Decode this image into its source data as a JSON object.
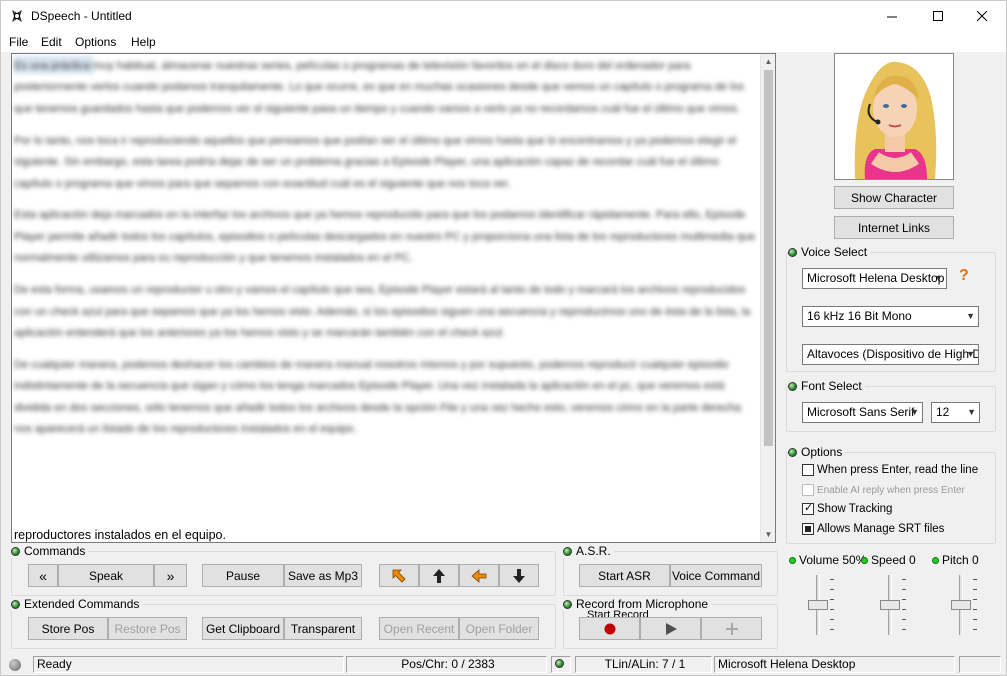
{
  "window": {
    "title": "DSpeech - Untitled"
  },
  "menu": {
    "file": "File",
    "edit": "Edit",
    "options": "Options",
    "help": "Help"
  },
  "editor": {
    "paragraphs": [
      "Es una práctica muy habitual, almacenar nuestras series, películas o programas de televisión favoritos en el disco duro del ordenador para posteriormente verlos cuando podamos tranquilamente. Lo que ocurre, es que en muchas ocasiones desde que vemos un capítulo o programa de los que tenemos guardados hasta que podemos ver el siguiente pasa un tiempo y cuando vamos a verlo ya no recordamos cuál fue el último que vimos.",
      "Por lo tanto, nos toca ir reproduciendo aquellos que pensamos que podían ser el último que vimos hasta que lo encontramos y ya podemos elegir el siguiente. Sin embargo, esta tarea podría dejar de ser un problema gracias a Episode Player, una aplicación capaz de recordar cuál fue el último capítulo o programa que vimos para que sepamos con exactitud cuál es el siguiente que nos toca ver.",
      "Esta aplicación deja marcados en la interfaz los archivos que ya hemos reproducido para que los podamos identificar rápidamente. Para ello, Episode Player permite añadir todos los capítulos, episodios o películas descargados en nuestro PC y proporciona una lista de los reproductores multimedia que normalmente utilizamos para su reproducción y que tenemos instalados en el PC.",
      "De esta forma, usamos un reproductor u otro y vamos el capítulo que sea, Episode Player estará al tanto de todo y marcará los archivos reproducidos con un check azul para que sepamos que ya los hemos visto. Además, si los episodios siguen una secuencia y reproducimos uno de ésta de la lista, la aplicación entenderá que los anteriores ya los hemos visto y se marcarán también con el check azul.",
      "De cualquier manera, podemos deshacer los cambios de manera manual nosotros mismos y por supuesto, podemos reproducir cualquier episodio indistintamente de la secuencia que sigan y cómo los tenga marcados Episode Player. Una vez instalada la aplicación en el pc, que veremos está dividida en dos secciones, sólo tenemos que añadir todos los archivos desde la opción File y una vez hecho esto, veremos cómo en la parte derecha nos aparecerá un listado de los reproductores instalados en el equipo."
    ],
    "visible_last_line": "reproductores instalados en el equipo.",
    "visible_char_1": "el",
    "visible_char_2": "e"
  },
  "right_panel": {
    "show_character": "Show Character",
    "internet_links": "Internet Links",
    "voice_select_label": "Voice Select",
    "voice": "Microsoft Helena Desktop",
    "help_icon": "?",
    "format": "16 kHz 16 Bit Mono",
    "output_device": "Altavoces (Dispositivo de High D",
    "font_select_label": "Font Select",
    "font_name": "Microsoft Sans Serif",
    "font_size": "12",
    "options_label": "Options",
    "opt_enter_read": {
      "label": "When press Enter, read the line",
      "checked": false
    },
    "opt_ai_reply": {
      "label": "Enable AI reply when press Enter",
      "checked": false,
      "disabled": true
    },
    "opt_show_tracking": {
      "label": "Show Tracking",
      "checked": true
    },
    "opt_srt": {
      "label": "Allows Manage SRT files",
      "checked": true
    },
    "volume_label": "Volume 50%",
    "speed_label": "Speed 0",
    "pitch_label": "Pitch 0",
    "volume": 0.5,
    "speed": 0.5,
    "pitch": 0.5
  },
  "commands": {
    "label": "Commands",
    "prev": "«",
    "speak": "Speak",
    "next": "»",
    "pause": "Pause",
    "save_mp3": "Save as Mp3"
  },
  "asr": {
    "label": "A.S.R.",
    "start_asr": "Start ASR",
    "voice_command": "Voice Command"
  },
  "extended": {
    "label": "Extended Commands",
    "store_pos": "Store Pos",
    "restore_pos": "Restore Pos",
    "get_clipboard": "Get Clipboard",
    "transparent": "Transparent",
    "open_recent": "Open Recent",
    "open_folder": "Open Folder"
  },
  "record": {
    "label": "Record from Microphone",
    "partial": "Start Record"
  },
  "status": {
    "ready": "Ready",
    "pos": "Pos/Chr: 0 / 2383",
    "tlin": "TLin/ALin: 7 / 1",
    "voice": "Microsoft Helena Desktop"
  },
  "colors": {
    "record_dot": "#c00000",
    "arrow_orange": "#f08a00"
  }
}
